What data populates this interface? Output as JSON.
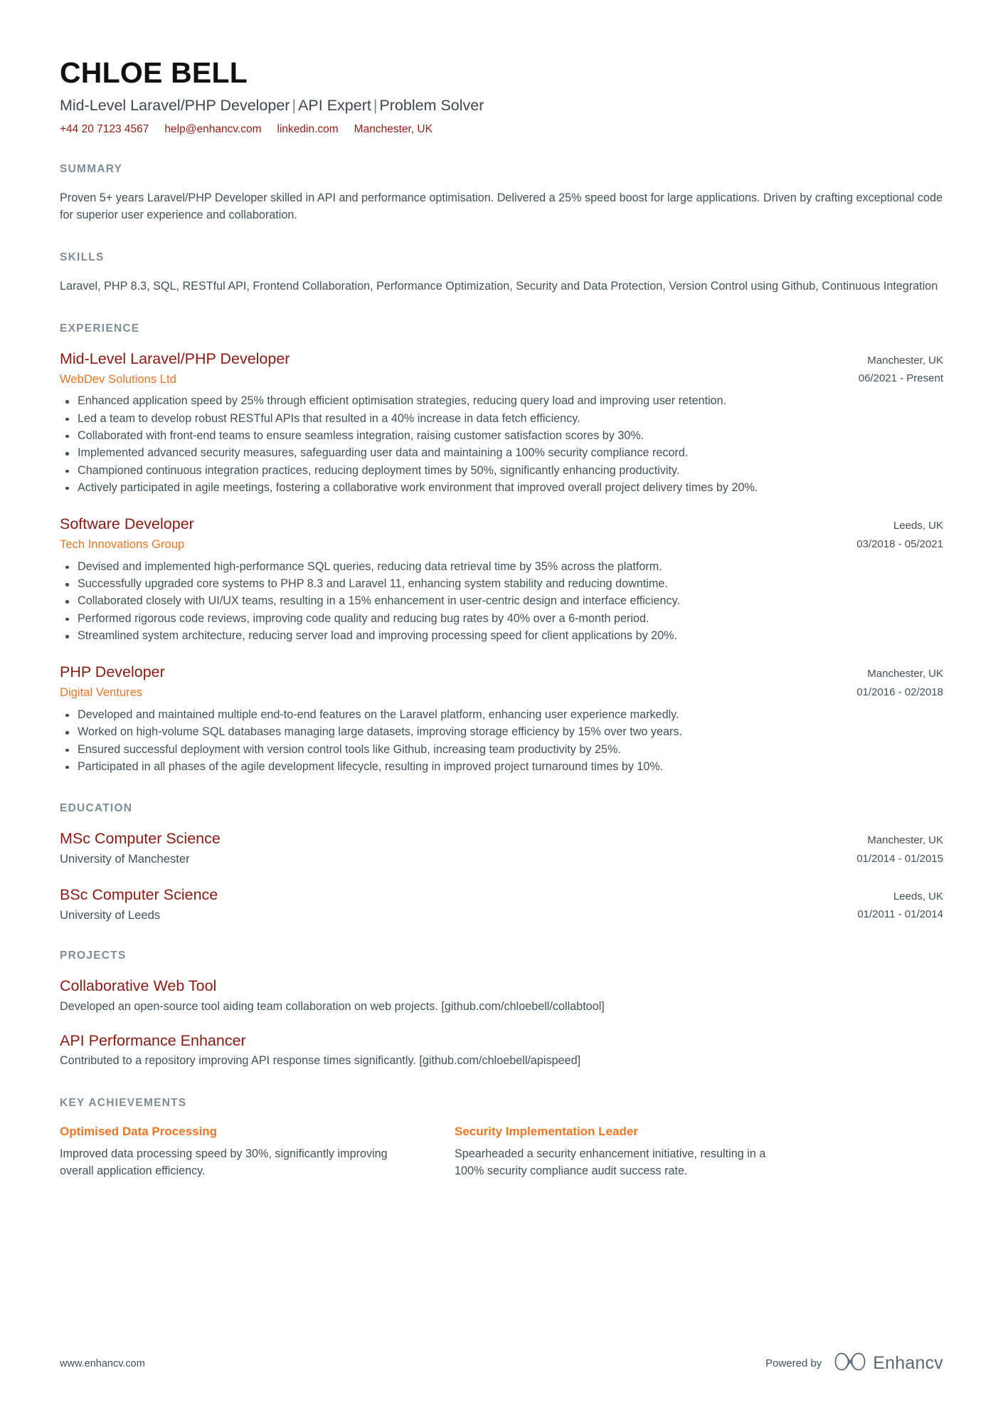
{
  "header": {
    "name": "CHLOE BELL",
    "headline_parts": [
      "Mid-Level Laravel/PHP Developer",
      "API Expert",
      "Problem Solver"
    ],
    "headline_separator": "|",
    "contact": {
      "phone": "+44 20 7123 4567",
      "email": "help@enhancv.com",
      "linkedin": "linkedin.com",
      "location": "Manchester, UK"
    }
  },
  "summary": {
    "title": "SUMMARY",
    "text": "Proven 5+ years Laravel/PHP Developer skilled in API and performance optimisation. Delivered a 25% speed boost for large applications. Driven by crafting exceptional code for superior user experience and collaboration."
  },
  "skills": {
    "title": "SKILLS",
    "text": "Laravel, PHP 8.3, SQL, RESTful API, Frontend Collaboration, Performance Optimization, Security and Data Protection, Version Control using Github, Continuous Integration"
  },
  "experience": {
    "title": "EXPERIENCE",
    "items": [
      {
        "role": "Mid-Level Laravel/PHP Developer",
        "company": "WebDev Solutions Ltd",
        "location": "Manchester, UK",
        "dates": "06/2021 - Present",
        "bullets": [
          "Enhanced application speed by 25% through efficient optimisation strategies, reducing query load and improving user retention.",
          "Led a team to develop robust RESTful APIs that resulted in a 40% increase in data fetch efficiency.",
          "Collaborated with front-end teams to ensure seamless integration, raising customer satisfaction scores by 30%.",
          "Implemented advanced security measures, safeguarding user data and maintaining a 100% security compliance record.",
          "Championed continuous integration practices, reducing deployment times by 50%, significantly enhancing productivity.",
          "Actively participated in agile meetings, fostering a collaborative work environment that improved overall project delivery times by 20%."
        ]
      },
      {
        "role": "Software Developer",
        "company": "Tech Innovations Group",
        "location": "Leeds, UK",
        "dates": "03/2018 - 05/2021",
        "bullets": [
          "Devised and implemented high-performance SQL queries, reducing data retrieval time by 35% across the platform.",
          "Successfully upgraded core systems to PHP 8.3 and Laravel 11, enhancing system stability and reducing downtime.",
          "Collaborated closely with UI/UX teams, resulting in a 15% enhancement in user-centric design and interface efficiency.",
          "Performed rigorous code reviews, improving code quality and reducing bug rates by 40% over a 6-month period.",
          "Streamlined system architecture, reducing server load and improving processing speed for client applications by 20%."
        ]
      },
      {
        "role": "PHP Developer",
        "company": "Digital Ventures",
        "location": "Manchester, UK",
        "dates": "01/2016 - 02/2018",
        "bullets": [
          "Developed and maintained multiple end-to-end features on the Laravel platform, enhancing user experience markedly.",
          "Worked on high-volume SQL databases managing large datasets, improving storage efficiency by 15% over two years.",
          "Ensured successful deployment with version control tools like Github, increasing team productivity by 25%.",
          "Participated in all phases of the agile development lifecycle, resulting in improved project turnaround times by 10%."
        ]
      }
    ]
  },
  "education": {
    "title": "EDUCATION",
    "items": [
      {
        "degree": "MSc Computer Science",
        "school": "University of Manchester",
        "location": "Manchester, UK",
        "dates": "01/2014 - 01/2015"
      },
      {
        "degree": "BSc Computer Science",
        "school": "University of Leeds",
        "location": "Leeds, UK",
        "dates": "01/2011 - 01/2014"
      }
    ]
  },
  "projects": {
    "title": "PROJECTS",
    "items": [
      {
        "name": "Collaborative Web Tool",
        "description": "Developed an open-source tool aiding team collaboration on web projects. [github.com/chloebell/collabtool]"
      },
      {
        "name": "API Performance Enhancer",
        "description": "Contributed to a repository improving API response times significantly. [github.com/chloebell/apispeed]"
      }
    ]
  },
  "key_achievements": {
    "title": "KEY ACHIEVEMENTS",
    "items": [
      {
        "name": "Optimised Data Processing",
        "description": "Improved data processing speed by 30%, significantly improving overall application efficiency."
      },
      {
        "name": "Security Implementation Leader",
        "description": "Spearheaded a security enhancement initiative, resulting in a 100% security compliance audit success rate."
      }
    ]
  },
  "footer": {
    "url": "www.enhancv.com",
    "powered_by": "Powered by",
    "brand": "Enhancv"
  },
  "colors": {
    "accent_red": "#8e1812",
    "accent_orange": "#f4741f",
    "contact_red": "#991b12",
    "section_heading": "#7e8c97",
    "body": "#41505a"
  }
}
